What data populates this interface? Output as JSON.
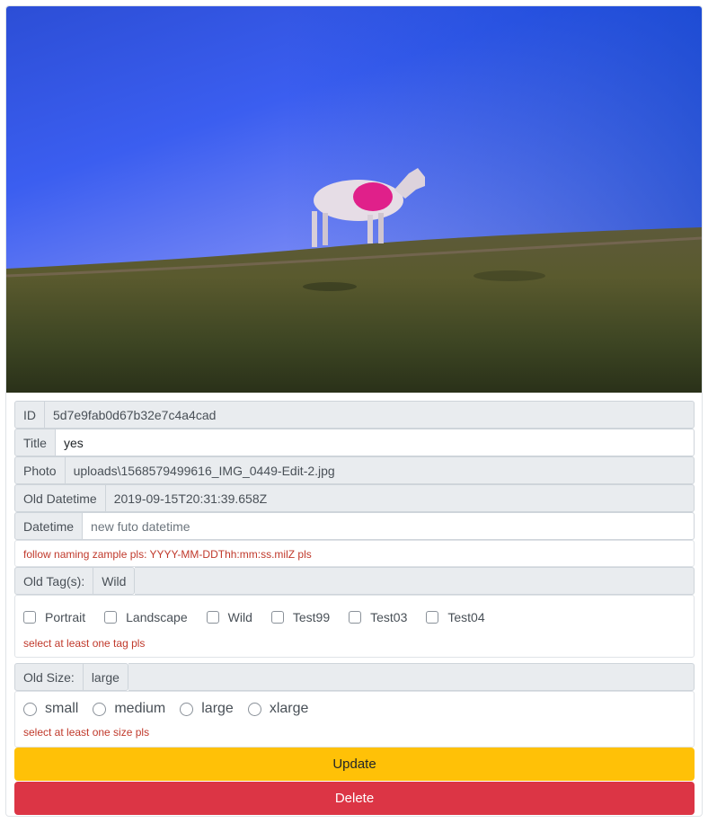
{
  "photo": {
    "alt": "Sheep on a grassy hill under a blue sky"
  },
  "fields": {
    "id": {
      "label": "ID",
      "value": "5d7e9fab0d67b32e7c4a4cad"
    },
    "title": {
      "label": "Title",
      "value": "yes"
    },
    "photo": {
      "label": "Photo",
      "value": "uploads\\1568579499616_IMG_0449-Edit-2.jpg"
    },
    "old_datetime": {
      "label": "Old Datetime",
      "value": "2019-09-15T20:31:39.658Z"
    },
    "datetime": {
      "label": "Datetime",
      "placeholder": "new futo datetime",
      "error": "follow naming zample pls: YYYY-MM-DDThh:mm:ss.milZ pls"
    },
    "old_tags": {
      "label": "Old Tag(s):",
      "value": "Wild"
    },
    "tags": {
      "options": [
        "Portrait",
        "Landscape",
        "Wild",
        "Test99",
        "Test03",
        "Test04"
      ],
      "error": "select at least one tag pls"
    },
    "old_size": {
      "label": "Old Size:",
      "value": "large"
    },
    "sizes": {
      "options": [
        "small",
        "medium",
        "large",
        "xlarge"
      ],
      "error": "select at least one size pls"
    }
  },
  "buttons": {
    "update": "Update",
    "delete": "Delete"
  },
  "colors": {
    "update": "#ffc107",
    "delete": "#dc3545",
    "error": "#c0392b",
    "readonly_bg": "#e9ecef"
  }
}
